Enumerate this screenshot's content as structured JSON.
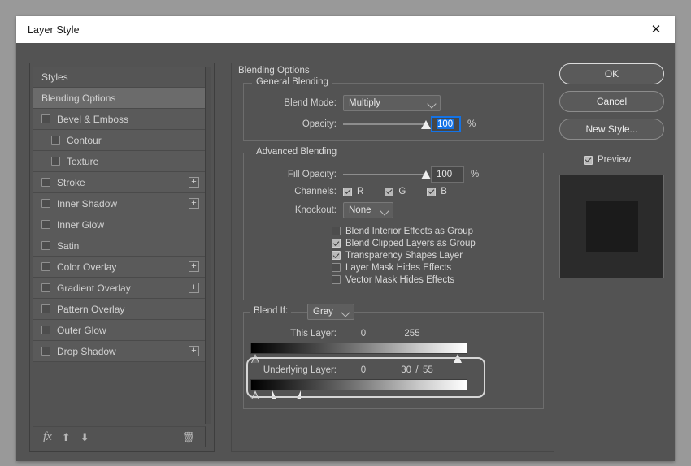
{
  "window": {
    "title": "Layer Style",
    "close_icon": "close-icon"
  },
  "sidebar": {
    "items": [
      {
        "label": "Styles",
        "type": "header",
        "checkbox": null,
        "plus": false,
        "selected": false
      },
      {
        "label": "Blending Options",
        "type": "header",
        "checkbox": null,
        "plus": false,
        "selected": true
      },
      {
        "label": "Bevel & Emboss",
        "type": "effect",
        "checkbox": false,
        "plus": false,
        "selected": false
      },
      {
        "label": "Contour",
        "type": "sub",
        "checkbox": false,
        "plus": false,
        "selected": false
      },
      {
        "label": "Texture",
        "type": "sub",
        "checkbox": false,
        "plus": false,
        "selected": false
      },
      {
        "label": "Stroke",
        "type": "effect",
        "checkbox": false,
        "plus": true,
        "selected": false
      },
      {
        "label": "Inner Shadow",
        "type": "effect",
        "checkbox": false,
        "plus": true,
        "selected": false
      },
      {
        "label": "Inner Glow",
        "type": "effect",
        "checkbox": false,
        "plus": false,
        "selected": false
      },
      {
        "label": "Satin",
        "type": "effect",
        "checkbox": false,
        "plus": false,
        "selected": false
      },
      {
        "label": "Color Overlay",
        "type": "effect",
        "checkbox": false,
        "plus": true,
        "selected": false
      },
      {
        "label": "Gradient Overlay",
        "type": "effect",
        "checkbox": false,
        "plus": true,
        "selected": false
      },
      {
        "label": "Pattern Overlay",
        "type": "effect",
        "checkbox": false,
        "plus": false,
        "selected": false
      },
      {
        "label": "Outer Glow",
        "type": "effect",
        "checkbox": false,
        "plus": false,
        "selected": false
      },
      {
        "label": "Drop Shadow",
        "type": "effect",
        "checkbox": false,
        "plus": true,
        "selected": false
      }
    ],
    "tools": {
      "fx_label": "fx",
      "move_up_icon": "arrow-up-icon",
      "move_down_icon": "arrow-down-icon",
      "delete_icon": "trash-icon"
    }
  },
  "blending_options": {
    "group_title": "Blending Options",
    "general": {
      "group_title": "General Blending",
      "blend_mode_label": "Blend Mode:",
      "blend_mode_value": "Multiply",
      "opacity_label": "Opacity:",
      "opacity_value": "100",
      "opacity_unit": "%",
      "opacity_slider_percent": 100,
      "opacity_focused": true
    },
    "advanced": {
      "group_title": "Advanced Blending",
      "fill_opacity_label": "Fill Opacity:",
      "fill_opacity_value": "100",
      "fill_opacity_unit": "%",
      "fill_opacity_slider_percent": 100,
      "channels_label": "Channels:",
      "channels": [
        {
          "label": "R",
          "checked": true
        },
        {
          "label": "G",
          "checked": true
        },
        {
          "label": "B",
          "checked": true
        }
      ],
      "knockout_label": "Knockout:",
      "knockout_value": "None",
      "options": [
        {
          "label": "Blend Interior Effects as Group",
          "checked": false
        },
        {
          "label": "Blend Clipped Layers as Group",
          "checked": true
        },
        {
          "label": "Transparency Shapes Layer",
          "checked": true
        },
        {
          "label": "Layer Mask Hides Effects",
          "checked": false
        },
        {
          "label": "Vector Mask Hides Effects",
          "checked": false
        }
      ]
    },
    "blend_if": {
      "label": "Blend If:",
      "channel_value": "Gray",
      "this_layer": {
        "label": "This Layer:",
        "black_value": "0",
        "white_value": "255",
        "focused": false
      },
      "underlying_layer": {
        "label": "Underlying Layer:",
        "black_value": "0",
        "white_value_left": "30",
        "separator": "/",
        "white_value_right": "55",
        "focused": true
      }
    }
  },
  "actions": {
    "ok_label": "OK",
    "cancel_label": "Cancel",
    "new_style_label": "New Style...",
    "preview_label": "Preview",
    "preview_checked": true
  },
  "colors": {
    "dialog_bg": "#535353",
    "accent_blue": "#1473e6",
    "focus_ring": "#d6d6d6",
    "page_backdrop": "#999999"
  }
}
